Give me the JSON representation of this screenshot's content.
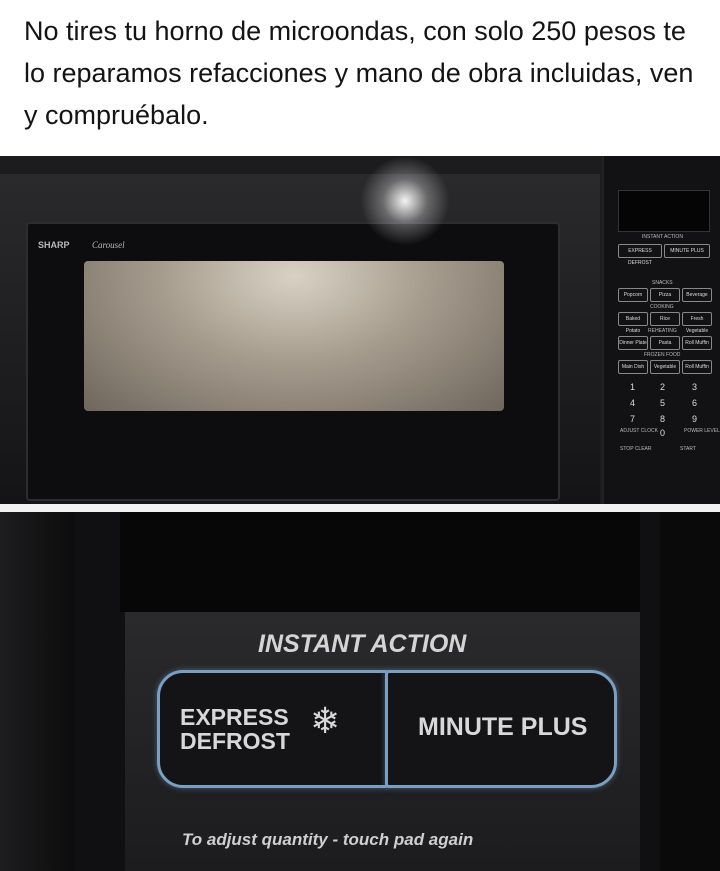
{
  "post": {
    "text": "No tires tu horno de microondas, con solo 250 pesos te lo reparamos refacciones y mano de obra incluidas, ven y compruébalo."
  },
  "photo1": {
    "brand": "SHARP",
    "brand_model": "Carousel",
    "panel": {
      "instant_action": "INSTANT ACTION",
      "express_defrost": "EXPRESS DEFROST",
      "minute_plus": "MINUTE PLUS",
      "row_labels": [
        "SNACKS",
        "COOKING",
        "REHEATING",
        "FROZEN FOOD"
      ],
      "buttons": [
        [
          "Popcorn",
          "Pizza",
          "Beverage"
        ],
        [
          "Baked Potato",
          "Rice",
          "Fresh Vegetable"
        ],
        [
          "Dinner Plate",
          "Pasta",
          "Roll Muffin"
        ],
        [
          "Main Dish",
          "Vegetable",
          "Roll Muffin"
        ]
      ],
      "keypad": [
        "1",
        "2",
        "3",
        "4",
        "5",
        "6",
        "7",
        "8",
        "9"
      ],
      "adjust_clock": "ADJUST CLOCK",
      "zero": "0",
      "power_level": "POWER LEVEL",
      "stop_clear": "STOP CLEAR",
      "start": "START"
    }
  },
  "photo2": {
    "instant_action": "INSTANT ACTION",
    "express_line1": "EXPRESS",
    "express_line2": "DEFROST",
    "minute_plus": "MINUTE PLUS",
    "hint": "To adjust quantity - touch pad again"
  },
  "colors": {
    "post_text": "#141414",
    "button_outline": "#7a9fc2",
    "panel_text": "#d4d4d4"
  }
}
